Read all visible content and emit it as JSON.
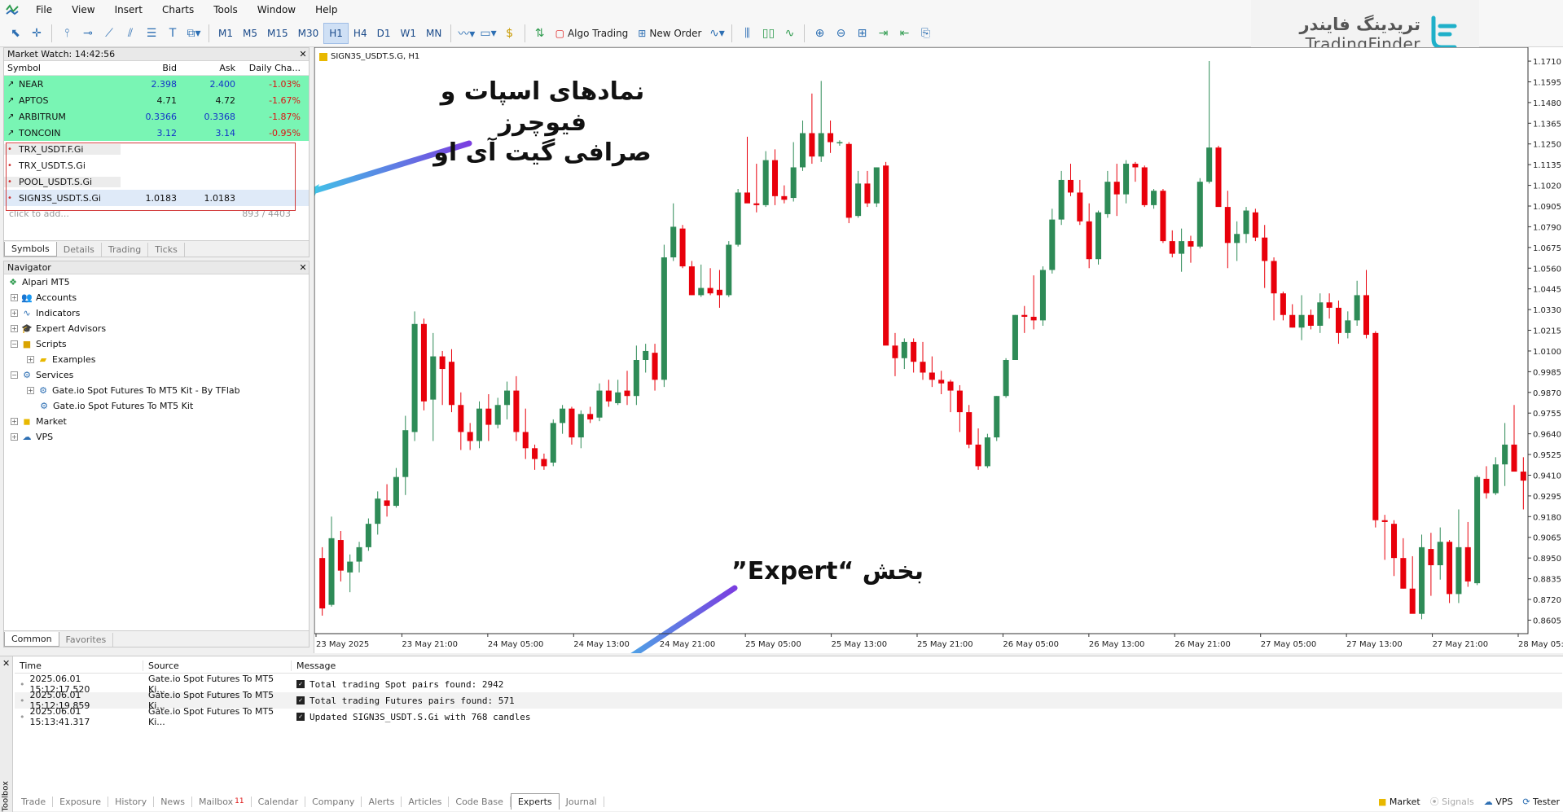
{
  "menu": [
    "File",
    "View",
    "Insert",
    "Charts",
    "Tools",
    "Window",
    "Help"
  ],
  "timeframes": [
    "M1",
    "M5",
    "M15",
    "M30",
    "H1",
    "H4",
    "D1",
    "W1",
    "MN"
  ],
  "active_timeframe": "H1",
  "toolbar": {
    "algo_trading": "Algo Trading",
    "new_order": "New Order"
  },
  "watermark": {
    "fa": "تریدینگ فایندر",
    "en": "TradingFinder"
  },
  "market_watch": {
    "title": "Market Watch: 14:42:56",
    "columns": [
      "Symbol",
      "Bid",
      "Ask",
      "Daily Cha..."
    ],
    "rows": [
      {
        "symbol": "NEAR",
        "bid": "2.398",
        "ask": "2.400",
        "change": "-1.03%"
      },
      {
        "symbol": "APTOS",
        "bid": "4.71",
        "ask": "4.72",
        "change": "-1.67%"
      },
      {
        "symbol": "ARBITRUM",
        "bid": "0.3366",
        "ask": "0.3368",
        "change": "-1.87%"
      },
      {
        "symbol": "TONCOIN",
        "bid": "3.12",
        "ask": "3.14",
        "change": "-0.95%"
      },
      {
        "symbol": "TRX_USDT.F.Gi",
        "bid": "",
        "ask": "",
        "change": ""
      },
      {
        "symbol": "TRX_USDT.S.Gi",
        "bid": "",
        "ask": "",
        "change": ""
      },
      {
        "symbol": "POOL_USDT.S.Gi",
        "bid": "",
        "ask": "",
        "change": ""
      },
      {
        "symbol": "SIGN3S_USDT.S.Gi",
        "bid": "1.0183",
        "ask": "1.0183",
        "change": ""
      }
    ],
    "add_hint": "click to add...",
    "count": "893 / 4403",
    "tabs": [
      "Symbols",
      "Details",
      "Trading",
      "Ticks"
    ]
  },
  "navigator": {
    "title": "Navigator",
    "items": {
      "root": "Alpari MT5",
      "accounts": "Accounts",
      "indicators": "Indicators",
      "experts": "Expert Advisors",
      "scripts": "Scripts",
      "examples": "Examples",
      "services": "Services",
      "service1": "Gate.io Spot Futures To MT5 Kit - By TFlab",
      "service2": "Gate.io Spot Futures To MT5 Kit",
      "market": "Market",
      "vps": "VPS"
    },
    "tabs": [
      "Common",
      "Favorites"
    ]
  },
  "chart": {
    "label": "SIGN3S_USDT.S.G, H1",
    "annotation_top": "نمادهای اسپات و فیوچرز\nصرافی گیت آی او",
    "annotation_bottom": "بخش “Expert”",
    "up_color": "#2e8b57",
    "down_color": "#e8000b"
  },
  "chart_data": {
    "type": "candlestick",
    "y_ticks": [
      "1.1710",
      "1.1595",
      "1.1480",
      "1.1365",
      "1.1250",
      "1.1135",
      "1.1020",
      "1.0905",
      "1.0790",
      "1.0675",
      "1.0560",
      "1.0445",
      "1.0330",
      "1.0215",
      "1.0100",
      "0.9985",
      "0.9870",
      "0.9755",
      "0.9640",
      "0.9525",
      "0.9410",
      "0.9295",
      "0.9180",
      "0.9065",
      "0.8950",
      "0.8835",
      "0.8720",
      "0.8605"
    ],
    "x_ticks": [
      "23 May 2025",
      "23 May 21:00",
      "24 May 05:00",
      "24 May 13:00",
      "24 May 21:00",
      "25 May 05:00",
      "25 May 13:00",
      "25 May 21:00",
      "26 May 05:00",
      "26 May 13:00",
      "26 May 21:00",
      "27 May 05:00",
      "27 May 13:00",
      "27 May 21:00",
      "28 May 05:00"
    ],
    "ylim": [
      0.853,
      1.176
    ],
    "candles": [
      [
        0.895,
        0.901,
        0.863,
        0.867
      ],
      [
        0.869,
        0.918,
        0.868,
        0.906
      ],
      [
        0.905,
        0.91,
        0.882,
        0.888
      ],
      [
        0.887,
        0.897,
        0.876,
        0.893
      ],
      [
        0.893,
        0.904,
        0.887,
        0.901
      ],
      [
        0.901,
        0.917,
        0.899,
        0.914
      ],
      [
        0.914,
        0.932,
        0.908,
        0.928
      ],
      [
        0.927,
        0.936,
        0.918,
        0.924
      ],
      [
        0.924,
        0.945,
        0.923,
        0.94
      ],
      [
        0.94,
        0.974,
        0.93,
        0.966
      ],
      [
        0.965,
        1.032,
        0.96,
        1.025
      ],
      [
        1.025,
        1.028,
        0.977,
        0.982
      ],
      [
        0.983,
        1.02,
        0.96,
        1.007
      ],
      [
        1.007,
        1.01,
        0.98,
        1.0
      ],
      [
        1.004,
        1.011,
        0.976,
        0.98
      ],
      [
        0.98,
        0.987,
        0.955,
        0.965
      ],
      [
        0.965,
        0.97,
        0.955,
        0.96
      ],
      [
        0.96,
        0.982,
        0.956,
        0.978
      ],
      [
        0.978,
        0.986,
        0.96,
        0.969
      ],
      [
        0.969,
        0.984,
        0.967,
        0.98
      ],
      [
        0.98,
        0.993,
        0.972,
        0.988
      ],
      [
        0.988,
        0.996,
        0.96,
        0.965
      ],
      [
        0.965,
        0.978,
        0.95,
        0.956
      ],
      [
        0.956,
        0.958,
        0.944,
        0.95
      ],
      [
        0.95,
        0.953,
        0.944,
        0.946
      ],
      [
        0.948,
        0.972,
        0.946,
        0.97
      ],
      [
        0.97,
        0.98,
        0.964,
        0.978
      ],
      [
        0.978,
        0.979,
        0.958,
        0.962
      ],
      [
        0.962,
        0.977,
        0.956,
        0.975
      ],
      [
        0.975,
        0.979,
        0.97,
        0.972
      ],
      [
        0.973,
        0.992,
        0.971,
        0.988
      ],
      [
        0.988,
        0.994,
        0.979,
        0.982
      ],
      [
        0.981,
        0.994,
        0.98,
        0.987
      ],
      [
        0.988,
        0.999,
        0.98,
        0.985
      ],
      [
        0.985,
        1.013,
        0.98,
        1.005
      ],
      [
        1.005,
        1.014,
        0.998,
        1.01
      ],
      [
        1.009,
        1.014,
        0.988,
        0.994
      ],
      [
        0.994,
        1.069,
        0.99,
        1.062
      ],
      [
        1.062,
        1.092,
        1.06,
        1.079
      ],
      [
        1.078,
        1.08,
        1.056,
        1.057
      ],
      [
        1.057,
        1.06,
        1.041,
        1.041
      ],
      [
        1.041,
        1.058,
        1.04,
        1.045
      ],
      [
        1.045,
        1.056,
        1.041,
        1.042
      ],
      [
        1.044,
        1.055,
        1.034,
        1.041
      ],
      [
        1.041,
        1.071,
        1.04,
        1.069
      ],
      [
        1.069,
        1.1,
        1.068,
        1.098
      ],
      [
        1.098,
        1.129,
        1.095,
        1.092
      ],
      [
        1.092,
        1.114,
        1.087,
        1.091
      ],
      [
        1.091,
        1.121,
        1.09,
        1.116
      ],
      [
        1.116,
        1.122,
        1.091,
        1.096
      ],
      [
        1.096,
        1.102,
        1.092,
        1.094
      ],
      [
        1.095,
        1.126,
        1.093,
        1.112
      ],
      [
        1.112,
        1.138,
        1.11,
        1.131
      ],
      [
        1.131,
        1.153,
        1.114,
        1.118
      ],
      [
        1.118,
        1.16,
        1.115,
        1.131
      ],
      [
        1.131,
        1.138,
        1.12,
        1.126
      ],
      [
        1.126,
        1.127,
        1.124,
        1.126
      ],
      [
        1.125,
        1.126,
        1.081,
        1.084
      ],
      [
        1.085,
        1.11,
        1.084,
        1.103
      ],
      [
        1.103,
        1.11,
        1.09,
        1.092
      ],
      [
        1.092,
        1.112,
        1.09,
        1.112
      ],
      [
        1.113,
        1.115,
        1.065,
        1.013
      ],
      [
        1.013,
        1.02,
        0.996,
        1.006
      ],
      [
        1.006,
        1.017,
        1.0,
        1.015
      ],
      [
        1.015,
        1.017,
        0.998,
        1.004
      ],
      [
        1.004,
        1.015,
        0.994,
        0.998
      ],
      [
        0.998,
        1.007,
        0.99,
        0.994
      ],
      [
        0.994,
        0.999,
        0.986,
        0.992
      ],
      [
        0.993,
        0.994,
        0.976,
        0.988
      ],
      [
        0.988,
        0.991,
        0.965,
        0.976
      ],
      [
        0.976,
        0.98,
        0.956,
        0.958
      ],
      [
        0.958,
        0.967,
        0.944,
        0.946
      ],
      [
        0.946,
        0.964,
        0.945,
        0.962
      ],
      [
        0.962,
        0.985,
        0.96,
        0.985
      ],
      [
        0.985,
        1.006,
        0.984,
        1.005
      ],
      [
        1.005,
        1.03,
        1.005,
        1.03
      ],
      [
        1.03,
        1.035,
        1.02,
        1.029
      ],
      [
        1.029,
        1.052,
        1.022,
        1.027
      ],
      [
        1.027,
        1.057,
        1.024,
        1.055
      ],
      [
        1.055,
        1.089,
        1.053,
        1.083
      ],
      [
        1.083,
        1.11,
        1.08,
        1.105
      ],
      [
        1.105,
        1.114,
        1.096,
        1.098
      ],
      [
        1.098,
        1.105,
        1.08,
        1.082
      ],
      [
        1.082,
        1.092,
        1.056,
        1.061
      ],
      [
        1.061,
        1.088,
        1.058,
        1.087
      ],
      [
        1.086,
        1.11,
        1.084,
        1.104
      ],
      [
        1.104,
        1.114,
        1.085,
        1.097
      ],
      [
        1.097,
        1.116,
        1.092,
        1.114
      ],
      [
        1.114,
        1.115,
        1.104,
        1.112
      ],
      [
        1.112,
        1.113,
        1.09,
        1.091
      ],
      [
        1.091,
        1.1,
        1.089,
        1.099
      ],
      [
        1.099,
        1.1,
        1.07,
        1.071
      ],
      [
        1.071,
        1.077,
        1.062,
        1.064
      ],
      [
        1.064,
        1.078,
        1.054,
        1.071
      ],
      [
        1.071,
        1.074,
        1.059,
        1.068
      ],
      [
        1.068,
        1.106,
        1.067,
        1.104
      ],
      [
        1.104,
        1.171,
        1.103,
        1.123
      ],
      [
        1.123,
        1.124,
        1.091,
        1.09
      ],
      [
        1.09,
        1.099,
        1.056,
        1.07
      ],
      [
        1.07,
        1.082,
        1.06,
        1.075
      ],
      [
        1.075,
        1.09,
        1.07,
        1.088
      ],
      [
        1.087,
        1.089,
        1.071,
        1.073
      ],
      [
        1.073,
        1.08,
        1.045,
        1.06
      ],
      [
        1.06,
        1.062,
        1.027,
        1.042
      ],
      [
        1.042,
        1.043,
        1.027,
        1.03
      ],
      [
        1.03,
        1.036,
        1.023,
        1.023
      ],
      [
        1.023,
        1.041,
        1.016,
        1.03
      ],
      [
        1.03,
        1.033,
        1.022,
        1.024
      ],
      [
        1.024,
        1.042,
        1.02,
        1.037
      ],
      [
        1.037,
        1.042,
        1.028,
        1.034
      ],
      [
        1.034,
        1.038,
        1.014,
        1.02
      ],
      [
        1.02,
        1.032,
        1.017,
        1.027
      ],
      [
        1.027,
        1.049,
        1.024,
        1.041
      ],
      [
        1.041,
        1.055,
        1.017,
        1.019
      ],
      [
        1.02,
        1.021,
        0.912,
        0.916
      ],
      [
        0.916,
        0.919,
        0.894,
        0.915
      ],
      [
        0.914,
        0.916,
        0.885,
        0.895
      ],
      [
        0.895,
        0.906,
        0.878,
        0.878
      ],
      [
        0.878,
        0.896,
        0.867,
        0.864
      ],
      [
        0.864,
        0.908,
        0.861,
        0.901
      ],
      [
        0.9,
        0.909,
        0.874,
        0.891
      ],
      [
        0.891,
        0.912,
        0.883,
        0.904
      ],
      [
        0.904,
        0.905,
        0.87,
        0.875
      ],
      [
        0.875,
        0.922,
        0.87,
        0.901
      ],
      [
        0.901,
        0.915,
        0.879,
        0.882
      ],
      [
        0.881,
        0.941,
        0.88,
        0.94
      ],
      [
        0.939,
        0.946,
        0.928,
        0.931
      ],
      [
        0.931,
        0.951,
        0.93,
        0.947
      ],
      [
        0.947,
        0.97,
        0.935,
        0.958
      ],
      [
        0.958,
        0.98,
        0.944,
        0.943
      ],
      [
        0.943,
        0.951,
        0.922,
        0.938
      ]
    ]
  },
  "toolbox": {
    "label": "Toolbox",
    "columns": [
      "Time",
      "Source",
      "Message"
    ],
    "rows": [
      {
        "time": "2025.06.01 15:12:17.520",
        "source": "Gate.io Spot Futures To MT5 Ki...",
        "message": "Total trading Spot pairs found: 2942"
      },
      {
        "time": "2025.06.01 15:12:19.859",
        "source": "Gate.io Spot Futures To MT5 Ki...",
        "message": "Total trading Futures pairs found: 571"
      },
      {
        "time": "2025.06.01 15:13:41.317",
        "source": "Gate.io Spot Futures To MT5 Ki...",
        "message": "Updated SIGN3S_USDT.S.Gi with 768 candles"
      }
    ],
    "tabs": [
      "Trade",
      "Exposure",
      "History",
      "News",
      "Mailbox",
      "Calendar",
      "Company",
      "Alerts",
      "Articles",
      "Code Base",
      "Experts",
      "Journal"
    ],
    "mailbox_badge": "11",
    "active_tab": "Experts",
    "right": [
      "Market",
      "Signals",
      "VPS",
      "Tester"
    ]
  }
}
